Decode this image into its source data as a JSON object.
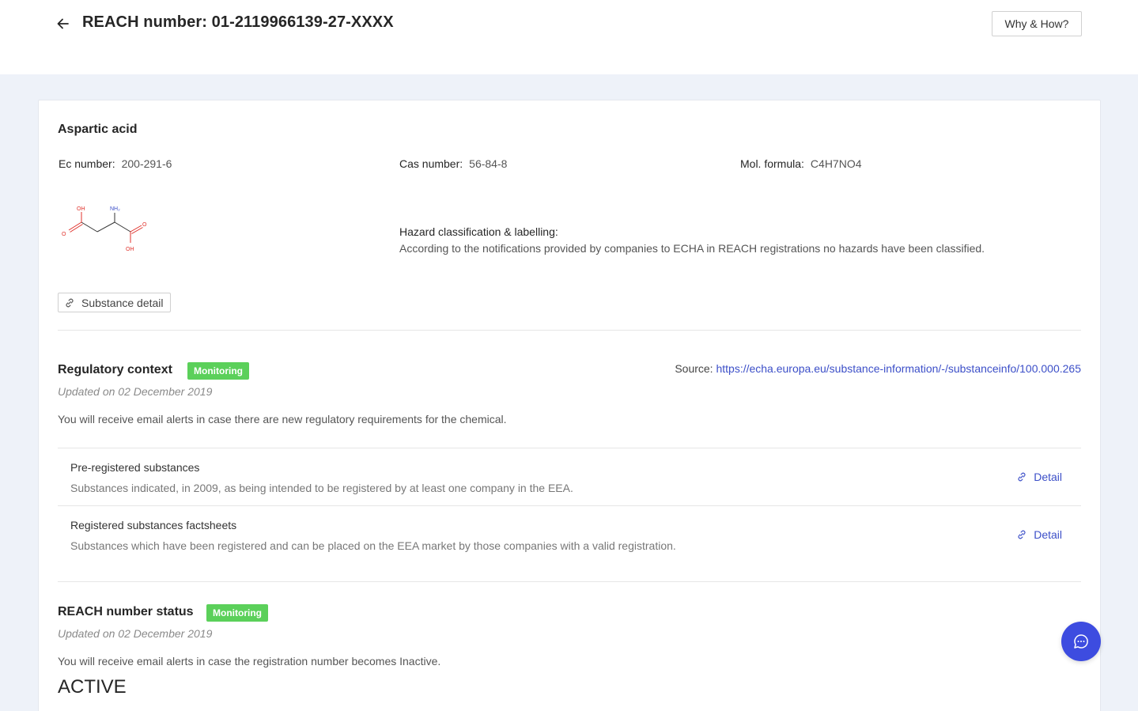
{
  "header": {
    "title": "REACH number: 01-2119966139-27-XXXX",
    "help_button": "Why & How?"
  },
  "substance": {
    "name": "Aspartic acid",
    "ec_label": "Ec number",
    "ec_value": "200-291-6",
    "cas_label": "Cas number",
    "cas_value": "56-84-8",
    "formula_label": "Mol. formula",
    "formula_value": "C4H7NO4",
    "structure_atoms": [
      "OH",
      "NH₂",
      "O",
      "O",
      "OH"
    ],
    "hazard_label": "Hazard classification & labelling",
    "hazard_text": "According to the notifications provided by companies to ECHA in REACH registrations no hazards have been classified.",
    "detail_button": "Substance detail"
  },
  "regulatory": {
    "title": "Regulatory context",
    "badge": "Monitoring",
    "updated": "Updated on 02 December 2019",
    "source_label": "Source:",
    "source_url": "https://echa.europa.eu/substance-information/-/substanceinfo/100.000.265",
    "description": "You will receive email alerts in case there are new regulatory requirements for the chemical.",
    "items": [
      {
        "title": "Pre-registered substances",
        "description": "Substances indicated, in 2009, as being intended to be registered by at least one company in the EEA.",
        "link": "Detail"
      },
      {
        "title": "Registered substances factsheets",
        "description": "Substances which have been registered and can be placed on the EEA market by those companies with a valid registration.",
        "link": "Detail"
      }
    ]
  },
  "reach_status": {
    "title": "REACH number status",
    "badge": "Monitoring",
    "updated": "Updated on 02 December 2019",
    "description": "You will receive email alerts in case the registration number becomes Inactive.",
    "value": "ACTIVE"
  },
  "colors": {
    "accent": "#3d4ce0",
    "badge_green": "#5bd05a",
    "link_blue": "#3c4fc8",
    "page_bg": "#eef2f9"
  },
  "icons": {
    "back": "arrow-left-icon",
    "link": "link-icon",
    "chat": "chat-bubble-icon"
  }
}
